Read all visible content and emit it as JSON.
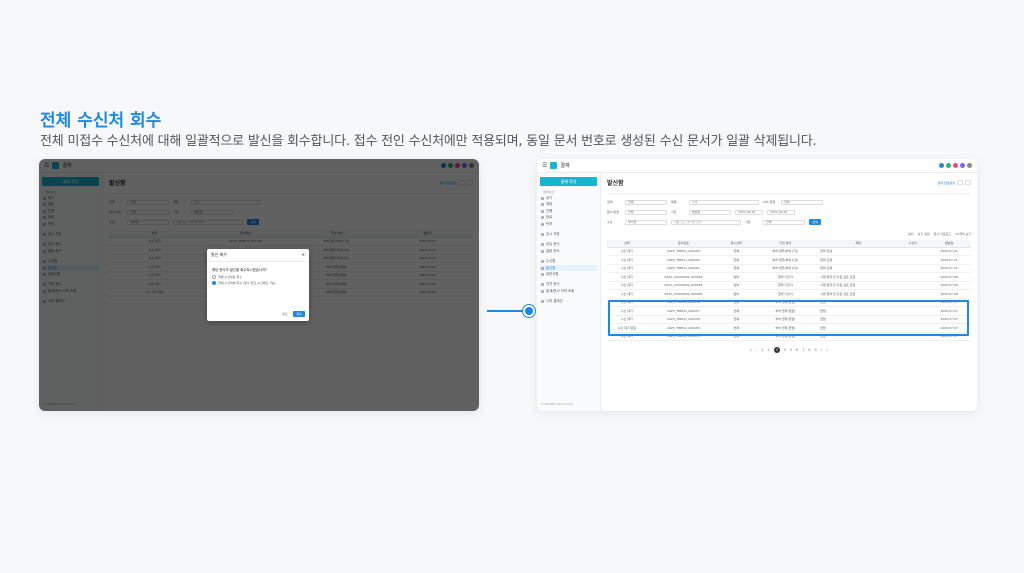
{
  "page": {
    "heading": "전체 수신처 회수",
    "subheading": "전체 미접수 수신처에 대해 일괄적으로 발신을 회수합니다. 접수 전인 수신처에만 적용되며, 동일 문서 번호로 생성된 수신 문서가 일괄 삭제됩니다."
  },
  "app": {
    "name": "결재",
    "new_button": "결재 작성",
    "page_title": "발신함",
    "footer": "© NAVER Cloud Corp.",
    "top_link": "결재 환경설정",
    "search_button": "검색",
    "colors": {
      "accent": "#1e88e5",
      "brand": "#19b5d0"
    }
  },
  "sidebar": {
    "groups": [
      {
        "title": "결재상신",
        "items": [
          "대기",
          "예정",
          "진행",
          "완료",
          "반려"
        ]
      },
      {
        "title": "",
        "items": [
          "임시 저장"
        ]
      },
      {
        "title": "",
        "items": [
          "공유 문서",
          "열람 문서"
        ]
      },
      {
        "title": "",
        "items": [
          "수신함",
          "발신함",
          "공문서함"
        ]
      },
      {
        "title": "",
        "items": [
          "의견 문서",
          "통계/문서 이력 조회"
        ]
      },
      {
        "title": "",
        "items": [
          "나의 결재선"
        ]
      }
    ],
    "active": "발신함"
  },
  "filters": {
    "row1": {
      "label1": "검색",
      "value1": "전체",
      "label2": "제목",
      "placeholder2": "제목",
      "label3": "서식 유형",
      "value3": "전체"
    },
    "row2": {
      "label1": "문서 번호",
      "value1": "전체",
      "label2": "기간",
      "value2": "발송일",
      "date_from": "2024.06.29",
      "date_to": "2024.09.29"
    },
    "row3": {
      "label1": "수신",
      "value1": "부서명",
      "placeholder": "이름 또는 부서명 입력",
      "label2": "기안",
      "value2": "전체"
    }
  },
  "table_tools": [
    "필터",
    "보기 설정",
    "문서 다운로드",
    "20개씩 보기"
  ],
  "table": {
    "headers": [
      "상태",
      "문서번호",
      "회수상태",
      "기안 부서",
      "제목",
      "수신자",
      "발송일"
    ],
    "rows": [
      [
        "수신 대기",
        "2025_TMM11_000163",
        "전체",
        "부처 업무(부처 [가])",
        "협력 안내",
        "",
        "2025.07.21"
      ],
      [
        "수신 대기",
        "2025_TMM11_000162",
        "전체",
        "부처 업무(부처 [나])",
        "협력 교류",
        "",
        "2025.07.21"
      ],
      [
        "수신 대기",
        "2025_TMM11_000161",
        "전체",
        "부처 업무(부처 [다])",
        "협력 교류",
        "",
        "2025.07.21"
      ],
      [
        "수신 대기",
        "2025_OUS00002_000018",
        "일부",
        "협력 기안자",
        "시행 협력 전 자료 검토 요청",
        "",
        "2025.07.08"
      ],
      [
        "수신 대기",
        "2025_OUS00002_000018",
        "일부",
        "협력 기안자",
        "시행 협력 전 자료 검토 요청",
        "",
        "2025.07.08"
      ],
      [
        "수신 대기",
        "2025_OUS00002_000018",
        "일부",
        "협력 기안자",
        "시행 협력 전 자료 검토 요청",
        "",
        "2025.07.08"
      ],
      [
        "수신 대기",
        "2025_TMM11_000158",
        "전체",
        "부처 업무(협업)",
        "협업",
        "",
        "2025.07.07"
      ],
      [
        "수신 대기",
        "2025_TMM11_000157",
        "전체",
        "부처 업무(협업)",
        "협업",
        "",
        "2025.07.07"
      ],
      [
        "수신 대기",
        "2025_TMM11_000156",
        "전체",
        "부처 업무(협업)",
        "협업",
        "",
        "2025.07.07"
      ],
      [
        "수신 대기 완료",
        "2025_TMM11_000155",
        "전체",
        "부처 업무(협업)",
        "협업",
        "",
        "2025.07.07"
      ],
      [
        "수신 대기",
        "2025_TMM11_000155",
        "전체",
        "부처 업무(협업)",
        "협업",
        "",
        "2025.07.07"
      ]
    ]
  },
  "pagination": [
    "«",
    "‹",
    "1",
    "2",
    "3",
    "4",
    "5",
    "6",
    "7",
    "8",
    "9",
    "›",
    "»"
  ],
  "pagination_current": "3",
  "modal": {
    "title": "발신 회수",
    "question": "해당 문서의 발신을 회수하시겠습니까?",
    "option1": "개별 수신처만 회수",
    "option2": "전체 수신처에 회수 (접수 전인 수신처만 가능)",
    "cancel": "취소",
    "confirm": "회수"
  }
}
